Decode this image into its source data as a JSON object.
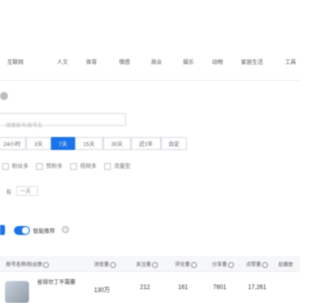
{
  "categories": [
    "互联网",
    "人文",
    "体育",
    "情感",
    "商业",
    "娱乐",
    "动物",
    "家居生活",
    "工具"
  ],
  "search": {
    "placeholder": "搜索账号/账号名"
  },
  "time_filters": {
    "options": [
      "24小时",
      "3天",
      "7天",
      "15天",
      "30天",
      "近1年",
      "自定"
    ],
    "selected": "7天"
  },
  "checks": [
    "粉丝多",
    "赞粉多",
    "视频多",
    "流量型"
  ],
  "row2": {
    "prefix": "有",
    "field": "一天"
  },
  "toggle": {
    "label": "智能推荐",
    "on": true
  },
  "info_glyph": "?",
  "table": {
    "headers": [
      "账号名称/粉丝数",
      "浏览量",
      "关注量",
      "评论量",
      "分享量",
      "点赞量",
      "总播放"
    ],
    "rows": [
      {
        "name": "省得勿丁不需要",
        "views": "130万",
        "follows": "212",
        "comments": "161",
        "shares": "7601",
        "likes": "17,261"
      }
    ]
  }
}
